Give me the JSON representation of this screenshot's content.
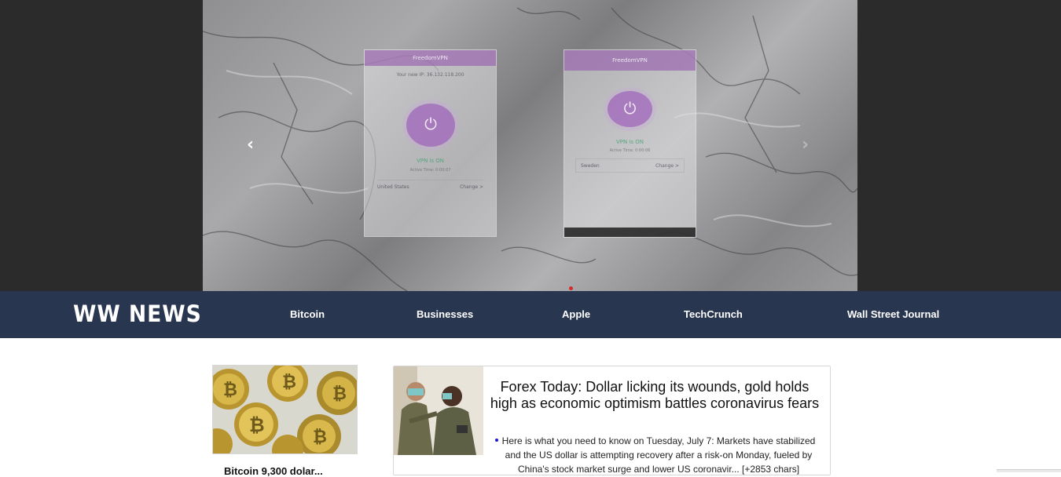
{
  "carousel": {
    "prev_icon": "chevron-left-icon",
    "next_icon": "chevron-right-icon",
    "prev_glyph": "‹",
    "next_glyph": "›",
    "active_indicator_color": "#d32b2b",
    "phone_left": {
      "app_name": "FreedomVPN",
      "ip_text": "Your new IP: 36.132.118.200",
      "status": "VPN is ON",
      "active_time": "Active Time: 0:00:07",
      "location": "United States",
      "change": "Change >"
    },
    "phone_right": {
      "app_name": "FreedomVPN",
      "status": "VPN is ON",
      "active_time": "Active Time: 0:00:06",
      "location": "Sweden",
      "change": "Change >"
    }
  },
  "nav": {
    "brand": "WW NEWS",
    "links": [
      "Bitcoin",
      "Businesses",
      "Apple",
      "TechCrunch",
      "Wall Street Journal"
    ],
    "background": "#283650"
  },
  "articles": {
    "side": {
      "title": "Bitcoin 9,300 dolar..."
    },
    "main": {
      "headline": "Forex Today: Dollar licking its wounds, gold holds high as economic optimism battles coronavirus fears",
      "description": "Here is what you need to know on Tuesday, July 7: Markets have stabilized and the US dollar is attempting recovery after a risk-on Monday, fueled by China's stock market surge and lower US coronavir... [+2853 chars]"
    }
  }
}
